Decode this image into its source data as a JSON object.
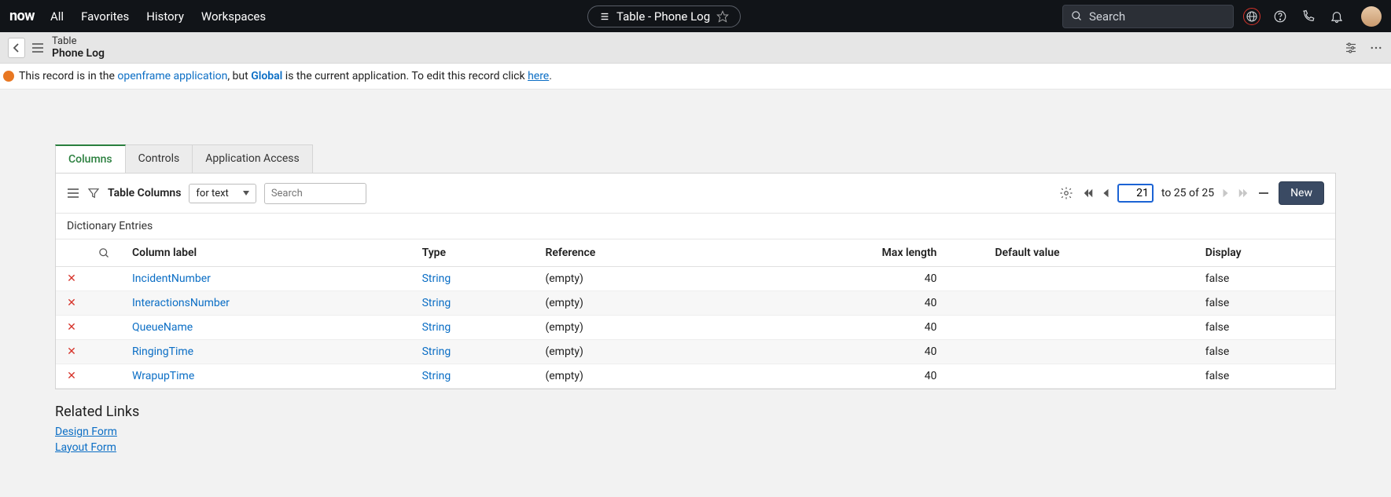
{
  "topnav": {
    "logo": "now",
    "links": [
      "All",
      "Favorites",
      "History",
      "Workspaces"
    ],
    "pill_title": "Table - Phone Log",
    "search_placeholder": "Search"
  },
  "subhead": {
    "line1": "Table",
    "line2": "Phone Log"
  },
  "alert": {
    "pre": "This record is in the ",
    "app_link": "openframe application",
    "mid1": ", but ",
    "global": "Global",
    "mid2": " is the current application. To edit this record click ",
    "here": "here",
    "post": "."
  },
  "tabs": {
    "columns": "Columns",
    "controls": "Controls",
    "appaccess": "Application Access"
  },
  "toolbar": {
    "title": "Table Columns",
    "select_value": "for text",
    "search_placeholder": "Search",
    "page_current": "21",
    "page_range": "to 25 of 25",
    "new_label": "New"
  },
  "section_title": "Dictionary Entries",
  "columns": {
    "label": "Column label",
    "type": "Type",
    "reference": "Reference",
    "maxlen": "Max length",
    "default": "Default value",
    "display": "Display"
  },
  "rows": [
    {
      "label": "IncidentNumber",
      "type": "String",
      "reference": "(empty)",
      "maxlen": "40",
      "default": "",
      "display": "false"
    },
    {
      "label": "InteractionsNumber",
      "type": "String",
      "reference": "(empty)",
      "maxlen": "40",
      "default": "",
      "display": "false"
    },
    {
      "label": "QueueName",
      "type": "String",
      "reference": "(empty)",
      "maxlen": "40",
      "default": "",
      "display": "false"
    },
    {
      "label": "RingingTime",
      "type": "String",
      "reference": "(empty)",
      "maxlen": "40",
      "default": "",
      "display": "false"
    },
    {
      "label": "WrapupTime",
      "type": "String",
      "reference": "(empty)",
      "maxlen": "40",
      "default": "",
      "display": "false"
    }
  ],
  "related": {
    "heading": "Related Links",
    "links": [
      "Design Form",
      "Layout Form"
    ]
  }
}
